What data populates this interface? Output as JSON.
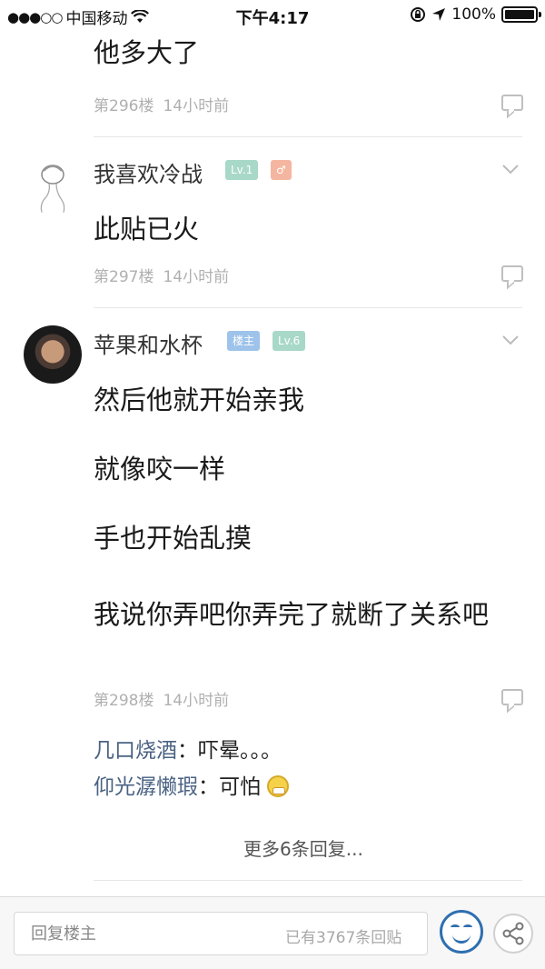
{
  "status_bar": {
    "carrier": "中国移动",
    "time": "下午4:17",
    "battery": "100%",
    "battery_level": 1.0
  },
  "posts": [
    {
      "text": [
        "他多大了"
      ],
      "floor": "第296楼",
      "time": "14小时前"
    },
    {
      "username": "我喜欢冷战",
      "badges": [
        "Lv.1",
        "♂"
      ],
      "text": [
        "此贴已火"
      ],
      "floor": "第297楼",
      "time": "14小时前"
    },
    {
      "username": "苹果和水杯",
      "badges": [
        "楼主",
        "Lv.6"
      ],
      "text": [
        "然后他就开始亲我",
        "就像咬一样",
        "手也开始乱摸",
        "我说你弄吧你弄完了就断了关系吧"
      ],
      "floor": "第298楼",
      "time": "14小时前",
      "replies": [
        {
          "user": "几口烧酒",
          "sep": "：",
          "text": "吓晕。。。"
        },
        {
          "user": "仰光潺懒瑕",
          "sep": "：",
          "text": "可怕"
        }
      ],
      "more": "更多6条回复..."
    }
  ],
  "bottom": {
    "input_placeholder": "回复楼主",
    "reply_count": "已有3767条回贴"
  },
  "colors": {
    "badge_level": "#a8d8c8",
    "badge_gender": "#f4b6a0",
    "badge_op": "#9ec3ea",
    "username": "#333333",
    "subreply_user": "#4a6283",
    "emoji_blue": "#2f6fb0"
  },
  "icons": [
    "signal-dots-icon",
    "wifi-icon",
    "lock-rotation-icon",
    "location-arrow-icon",
    "battery-icon",
    "chevron-down-icon",
    "comment-icon",
    "emoji-icon",
    "share-icon"
  ]
}
